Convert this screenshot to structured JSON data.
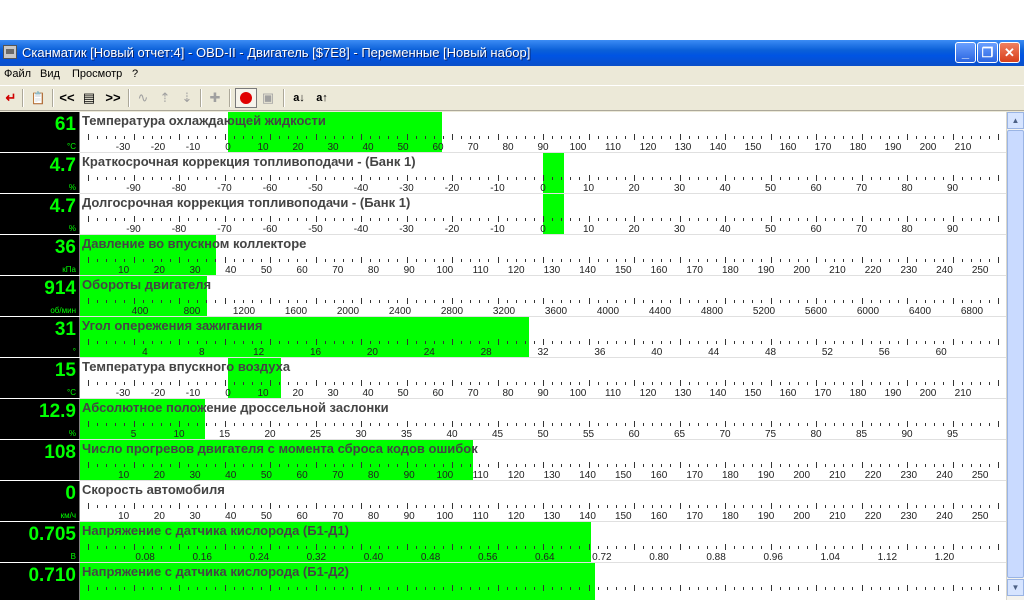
{
  "window": {
    "title": "Сканматик [Новый отчет:4] - OBD-II - Двигатель [$7E8] - Переменные [Новый набор]",
    "minimize": "_",
    "maximize": "❐",
    "close": "✕"
  },
  "menu": [
    "Файл",
    "Вид",
    "Просмотр",
    "?"
  ],
  "toolbar": {
    "exit_icon": "↵",
    "report_icon": "📋",
    "prev": "<<",
    "list_icon": "▤",
    "next": ">>",
    "graph_icon": "∿",
    "up_icon": "⇡",
    "down_icon": "⇣",
    "pin_icon": "✚",
    "record_icon": "record-icon",
    "image_icon": "▣",
    "sort_desc": "a↓",
    "sort_asc": "a↑"
  },
  "parameters": [
    {
      "name": "Температура охлаждающей жидкости",
      "value": "61",
      "unit": "°C",
      "min": -40,
      "max": 220,
      "bar_start": 0,
      "bar_end": 61,
      "labels": [
        "-30",
        "-20",
        "-10",
        "0",
        "10",
        "20",
        "30",
        "40",
        "50",
        "60",
        "70",
        "80",
        "90",
        "100",
        "110",
        "120",
        "130",
        "140",
        "150",
        "160",
        "170",
        "180",
        "190",
        "200",
        "210"
      ]
    },
    {
      "name": "Краткосрочная коррекция топливоподачи - (Банк 1)",
      "value": "4.7",
      "unit": "%",
      "min": -100,
      "max": 100,
      "bar_start": 0,
      "bar_end": 4.7,
      "labels": [
        "-90",
        "-80",
        "-70",
        "-60",
        "-50",
        "-40",
        "-30",
        "-20",
        "-10",
        "0",
        "10",
        "20",
        "30",
        "40",
        "50",
        "60",
        "70",
        "80",
        "90"
      ]
    },
    {
      "name": "Долгосрочная коррекция топливоподачи -  (Банк 1)",
      "value": "4.7",
      "unit": "%",
      "min": -100,
      "max": 100,
      "bar_start": 0,
      "bar_end": 4.7,
      "labels": [
        "-90",
        "-80",
        "-70",
        "-60",
        "-50",
        "-40",
        "-30",
        "-20",
        "-10",
        "0",
        "10",
        "20",
        "30",
        "40",
        "50",
        "60",
        "70",
        "80",
        "90"
      ]
    },
    {
      "name": "Давление во впускном коллекторе",
      "value": "36",
      "unit": "кПа",
      "min": 0,
      "max": 255,
      "bar_start": 0,
      "bar_end": 36,
      "labels": [
        "10",
        "20",
        "30",
        "40",
        "50",
        "60",
        "70",
        "80",
        "90",
        "100",
        "110",
        "120",
        "130",
        "140",
        "150",
        "160",
        "170",
        "180",
        "190",
        "200",
        "210",
        "220",
        "230",
        "240",
        "250"
      ]
    },
    {
      "name": "Обороты двигателя",
      "value": "914",
      "unit": "об/мин",
      "min": 0,
      "max": 7000,
      "bar_start": 0,
      "bar_end": 914,
      "labels": [
        "400",
        "800",
        "1200",
        "1600",
        "2000",
        "2400",
        "2800",
        "3200",
        "3600",
        "4000",
        "4400",
        "4800",
        "5200",
        "5600",
        "6000",
        "6400",
        "6800"
      ]
    },
    {
      "name": "Угол опережения зажигания",
      "value": "31",
      "unit": "°",
      "min": 0,
      "max": 64,
      "bar_start": 0,
      "bar_end": 31,
      "labels": [
        "4",
        "8",
        "12",
        "16",
        "20",
        "24",
        "28",
        "32",
        "36",
        "40",
        "44",
        "48",
        "52",
        "56",
        "60"
      ]
    },
    {
      "name": "Температура впускного воздуха",
      "value": "15",
      "unit": "°C",
      "min": -40,
      "max": 220,
      "bar_start": 0,
      "bar_end": 15,
      "labels": [
        "-30",
        "-20",
        "-10",
        "0",
        "10",
        "20",
        "30",
        "40",
        "50",
        "60",
        "70",
        "80",
        "90",
        "100",
        "110",
        "120",
        "130",
        "140",
        "150",
        "160",
        "170",
        "180",
        "190",
        "200",
        "210"
      ]
    },
    {
      "name": "Абсолютное положение дроссельной заслонки",
      "value": "12.9",
      "unit": "%",
      "min": 0,
      "max": 100,
      "bar_start": 0,
      "bar_end": 12.9,
      "labels": [
        "5",
        "10",
        "15",
        "20",
        "25",
        "30",
        "35",
        "40",
        "45",
        "50",
        "55",
        "60",
        "65",
        "70",
        "75",
        "80",
        "85",
        "90",
        "95"
      ]
    },
    {
      "name": "Число прогревов двигателя с момента сброса кодов ошибок",
      "value": "108",
      "unit": "",
      "min": 0,
      "max": 255,
      "bar_start": 0,
      "bar_end": 108,
      "labels": [
        "10",
        "20",
        "30",
        "40",
        "50",
        "60",
        "70",
        "80",
        "90",
        "100",
        "110",
        "120",
        "130",
        "140",
        "150",
        "160",
        "170",
        "180",
        "190",
        "200",
        "210",
        "220",
        "230",
        "240",
        "250"
      ]
    },
    {
      "name": "Скорость автомобиля",
      "value": "0",
      "unit": "км/ч",
      "min": 0,
      "max": 255,
      "bar_start": 0,
      "bar_end": 0,
      "labels": [
        "10",
        "20",
        "30",
        "40",
        "50",
        "60",
        "70",
        "80",
        "90",
        "100",
        "110",
        "120",
        "130",
        "140",
        "150",
        "160",
        "170",
        "180",
        "190",
        "200",
        "210",
        "220",
        "230",
        "240",
        "250"
      ]
    },
    {
      "name": "Напряжение с датчика кислорода (Б1-Д1)",
      "value": "0.705",
      "unit": "В",
      "min": 0,
      "max": 1.275,
      "bar_start": 0,
      "bar_end": 0.705,
      "labels": [
        "0.08",
        "0.16",
        "0.24",
        "0.32",
        "0.40",
        "0.48",
        "0.56",
        "0.64",
        "0.72",
        "0.80",
        "0.88",
        "0.96",
        "1.04",
        "1.12",
        "1.20"
      ]
    },
    {
      "name": "Напряжение с датчика кислорода (Б1-Д2)",
      "value": "0.710",
      "unit": "",
      "min": 0,
      "max": 1.275,
      "bar_start": 0,
      "bar_end": 0.71,
      "labels": []
    }
  ],
  "scrollbar": {
    "up": "▲",
    "down": "▼"
  }
}
